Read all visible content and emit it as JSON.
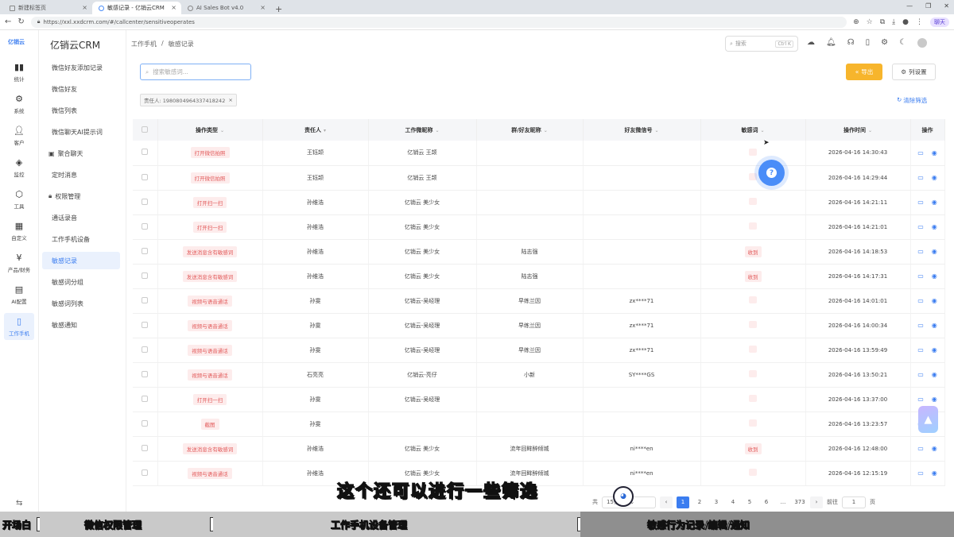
{
  "browser": {
    "tabs": [
      {
        "title": "新建标签页"
      },
      {
        "title": "敏感记录 - 亿销云CRM"
      },
      {
        "title": "AI Sales Bot v4.0"
      }
    ],
    "url": "https://xxl.xxdcrm.com/#/callcenter/sensitiveoperates",
    "profile_label": "聊天"
  },
  "iconbar": {
    "brand": "亿销云",
    "items": [
      {
        "label": "统计",
        "icon": "bar-chart-icon"
      },
      {
        "label": "系统",
        "icon": "gear-icon"
      },
      {
        "label": "客户",
        "icon": "user-icon"
      },
      {
        "label": "监控",
        "icon": "monitor-icon"
      },
      {
        "label": "工具",
        "icon": "box-icon"
      },
      {
        "label": "自定义",
        "icon": "grid-icon"
      },
      {
        "label": "产品/财务",
        "icon": "yen-icon"
      },
      {
        "label": "AI配置",
        "icon": "doc-icon"
      },
      {
        "label": "工作手机",
        "icon": "phone-icon"
      }
    ]
  },
  "menu": {
    "title": "亿销云CRM",
    "items": [
      {
        "label": "微信好友添加记录"
      },
      {
        "label": "微信好友"
      },
      {
        "label": "微信列表"
      },
      {
        "label": "微信聊天AI提示词"
      },
      {
        "label": "聚合聊天"
      },
      {
        "label": "定时消息"
      },
      {
        "label": "权限管理"
      },
      {
        "label": "通话录音"
      },
      {
        "label": "工作手机设备"
      },
      {
        "label": "敏感记录"
      },
      {
        "label": "敏感词分组"
      },
      {
        "label": "敏感词列表"
      },
      {
        "label": "敏感通知"
      }
    ]
  },
  "topnav": {
    "crumb1": "工作手机",
    "sep": "/",
    "crumb2": "敏感记录",
    "search_placeholder": "搜索",
    "kbd": "Ctrl K"
  },
  "toolbar": {
    "keyword_placeholder": "搜索敏感词...",
    "export_label": "导出",
    "columns_label": "列设置",
    "filter_tag": "责任人: 1980804964337418242",
    "clear_filter": "清除筛选"
  },
  "table": {
    "headers": [
      "操作类型",
      "责任人",
      "工作微昵称",
      "群/好友昵称",
      "好友微信号",
      "敏感词",
      "操作时间",
      "操作"
    ],
    "rows": [
      {
        "type": "打开微信拍照",
        "owner": "王钰颉",
        "wx": "亿销云 王颉",
        "group": "",
        "friend_id": "",
        "keyword": "",
        "time": "2026-04-16 14:30:43"
      },
      {
        "type": "打开微信拍照",
        "owner": "王钰颉",
        "wx": "亿销云 王颉",
        "group": "",
        "friend_id": "",
        "keyword": "",
        "time": "2026-04-16 14:29:44"
      },
      {
        "type": "打开扫一扫",
        "owner": "孙维浩",
        "wx": "亿销云 美少女",
        "group": "",
        "friend_id": "",
        "keyword": "",
        "time": "2026-04-16 14:21:11"
      },
      {
        "type": "打开扫一扫",
        "owner": "孙维浩",
        "wx": "亿销云 美少女",
        "group": "",
        "friend_id": "",
        "keyword": "",
        "time": "2026-04-16 14:21:01"
      },
      {
        "type": "发送消息含有敏感词",
        "owner": "孙维浩",
        "wx": "亿销云 美少女",
        "group": "陆志强",
        "friend_id": "",
        "keyword": "收到",
        "time": "2026-04-16 14:18:53"
      },
      {
        "type": "发送消息含有敏感词",
        "owner": "孙维浩",
        "wx": "亿销云 美少女",
        "group": "陆志强",
        "friend_id": "",
        "keyword": "收到",
        "time": "2026-04-16 14:17:31"
      },
      {
        "type": "视频与语音通话",
        "owner": "孙雯",
        "wx": "亿销云-吴经理",
        "group": "早练兰因",
        "friend_id": "zx****71",
        "keyword": "",
        "time": "2026-04-16 14:01:01"
      },
      {
        "type": "视频与语音通话",
        "owner": "孙雯",
        "wx": "亿销云-吴经理",
        "group": "早练兰因",
        "friend_id": "zx****71",
        "keyword": "",
        "time": "2026-04-16 14:00:34"
      },
      {
        "type": "视频与语音通话",
        "owner": "孙雯",
        "wx": "亿销云-吴经理",
        "group": "早练兰因",
        "friend_id": "zx****71",
        "keyword": "",
        "time": "2026-04-16 13:59:49"
      },
      {
        "type": "视频与语音通话",
        "owner": "石亮亮",
        "wx": "亿销云-亮仔",
        "group": "小新",
        "friend_id": "SY****GS",
        "keyword": "",
        "time": "2026-04-16 13:50:21"
      },
      {
        "type": "打开扫一扫",
        "owner": "孙雯",
        "wx": "亿销云-吴经理",
        "group": "",
        "friend_id": "",
        "keyword": "",
        "time": "2026-04-16 13:37:00"
      },
      {
        "type": "截图",
        "owner": "孙雯",
        "wx": "",
        "group": "",
        "friend_id": "",
        "keyword": "",
        "time": "2026-04-16 13:23:57"
      },
      {
        "type": "发送消息含有敏感词",
        "owner": "孙维浩",
        "wx": "亿销云 美少女",
        "group": "流年回眸醉倾城",
        "friend_id": "ni****en",
        "keyword": "收到",
        "time": "2026-04-16 12:48:00"
      },
      {
        "type": "视频与语音通话",
        "owner": "孙维浩",
        "wx": "亿销云 美少女",
        "group": "流年回眸醉倾城",
        "friend_id": "ni****en",
        "keyword": "",
        "time": "2026-04-16 12:15:19"
      }
    ]
  },
  "pagination": {
    "total_prefix": "共",
    "page_size": "15条/页",
    "pages": [
      "1",
      "2",
      "3",
      "4",
      "5",
      "6",
      "...",
      "373"
    ],
    "goto_label": "前往",
    "goto_value": "1",
    "page_suffix": "页"
  },
  "overlay": {
    "subtitle": "这个还可以进行一些筛选",
    "chapters": [
      "开场白",
      "微信权限管理",
      "工作手机设备管理",
      "敏感行为记录/编辑/通知"
    ]
  },
  "colors": {
    "primary": "#3b7df0",
    "export": "#f7b52c",
    "danger_tag": "#e25a5a"
  }
}
